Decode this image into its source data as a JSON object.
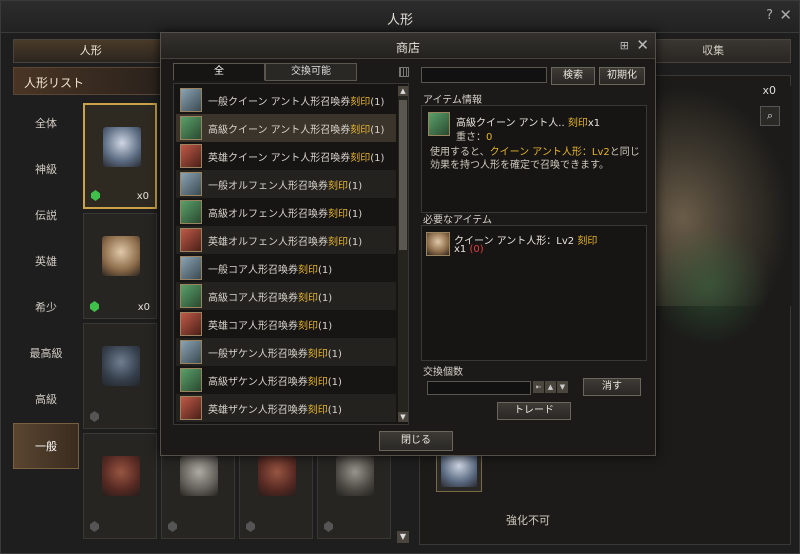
{
  "window": {
    "title": "人形",
    "help": "?",
    "close": "✕"
  },
  "main_tabs": [
    {
      "label": "人形"
    },
    {
      "label": ""
    },
    {
      "label": ""
    },
    {
      "label": ""
    },
    {
      "label": "収集"
    }
  ],
  "list_header": "人形リスト",
  "categories": [
    {
      "label": "全体"
    },
    {
      "label": "神級"
    },
    {
      "label": "伝説"
    },
    {
      "label": "英雄"
    },
    {
      "label": "希少"
    },
    {
      "label": "最高級"
    },
    {
      "label": "高級"
    },
    {
      "label": "一般"
    }
  ],
  "doll_slots": [
    {
      "count": "x0"
    },
    {
      "count": "x0"
    }
  ],
  "detail": {
    "count": "x0",
    "strengthen_note": "強化不可"
  },
  "shop": {
    "title": "商店",
    "tabs": [
      {
        "label": "全"
      },
      {
        "label": "交換可能"
      }
    ],
    "items": [
      {
        "name": "一般クイーン アント人形召喚券",
        "tag": "刻印",
        "qty": "(1)"
      },
      {
        "name": "高級クイーン アント人形召喚券",
        "tag": "刻印",
        "qty": "(1)"
      },
      {
        "name": "英雄クイーン アント人形召喚券",
        "tag": "刻印",
        "qty": "(1)"
      },
      {
        "name": "一般オルフェン人形召喚券",
        "tag": "刻印",
        "qty": "(1)"
      },
      {
        "name": "高級オルフェン人形召喚券",
        "tag": "刻印",
        "qty": "(1)"
      },
      {
        "name": "英雄オルフェン人形召喚券",
        "tag": "刻印",
        "qty": "(1)"
      },
      {
        "name": "一般コア人形召喚券",
        "tag": "刻印",
        "qty": "(1)"
      },
      {
        "name": "高級コア人形召喚券",
        "tag": "刻印",
        "qty": "(1)"
      },
      {
        "name": "英雄コア人形召喚券",
        "tag": "刻印",
        "qty": "(1)"
      },
      {
        "name": "一般ザケン人形召喚券",
        "tag": "刻印",
        "qty": "(1)"
      },
      {
        "name": "高級ザケン人形召喚券",
        "tag": "刻印",
        "qty": "(1)"
      },
      {
        "name": "英雄ザケン人形召喚券",
        "tag": "刻印",
        "qty": "(1)"
      }
    ],
    "search_button": "検索",
    "reset_button": "初期化",
    "item_info_label": "アイテム情報",
    "info": {
      "name": "高級クイーン アント人..",
      "tag": "刻印",
      "qty": "x1",
      "weight_label": "重さ：",
      "weight": "0",
      "desc_1": "使用すると、",
      "desc_hl": "クイーン アント人形：Lv2",
      "desc_2": "と同じ効果を持つ人形を確定で召喚できます。"
    },
    "required_label": "必要なアイテム",
    "required": {
      "name": "クイーン アント人形：Lv2",
      "tag": "刻印",
      "qty": "x1",
      "have": "(0)"
    },
    "exchange_label": "交換個数",
    "clear_button": "消す",
    "trade_button": "トレード",
    "close_button": "閉じる"
  }
}
